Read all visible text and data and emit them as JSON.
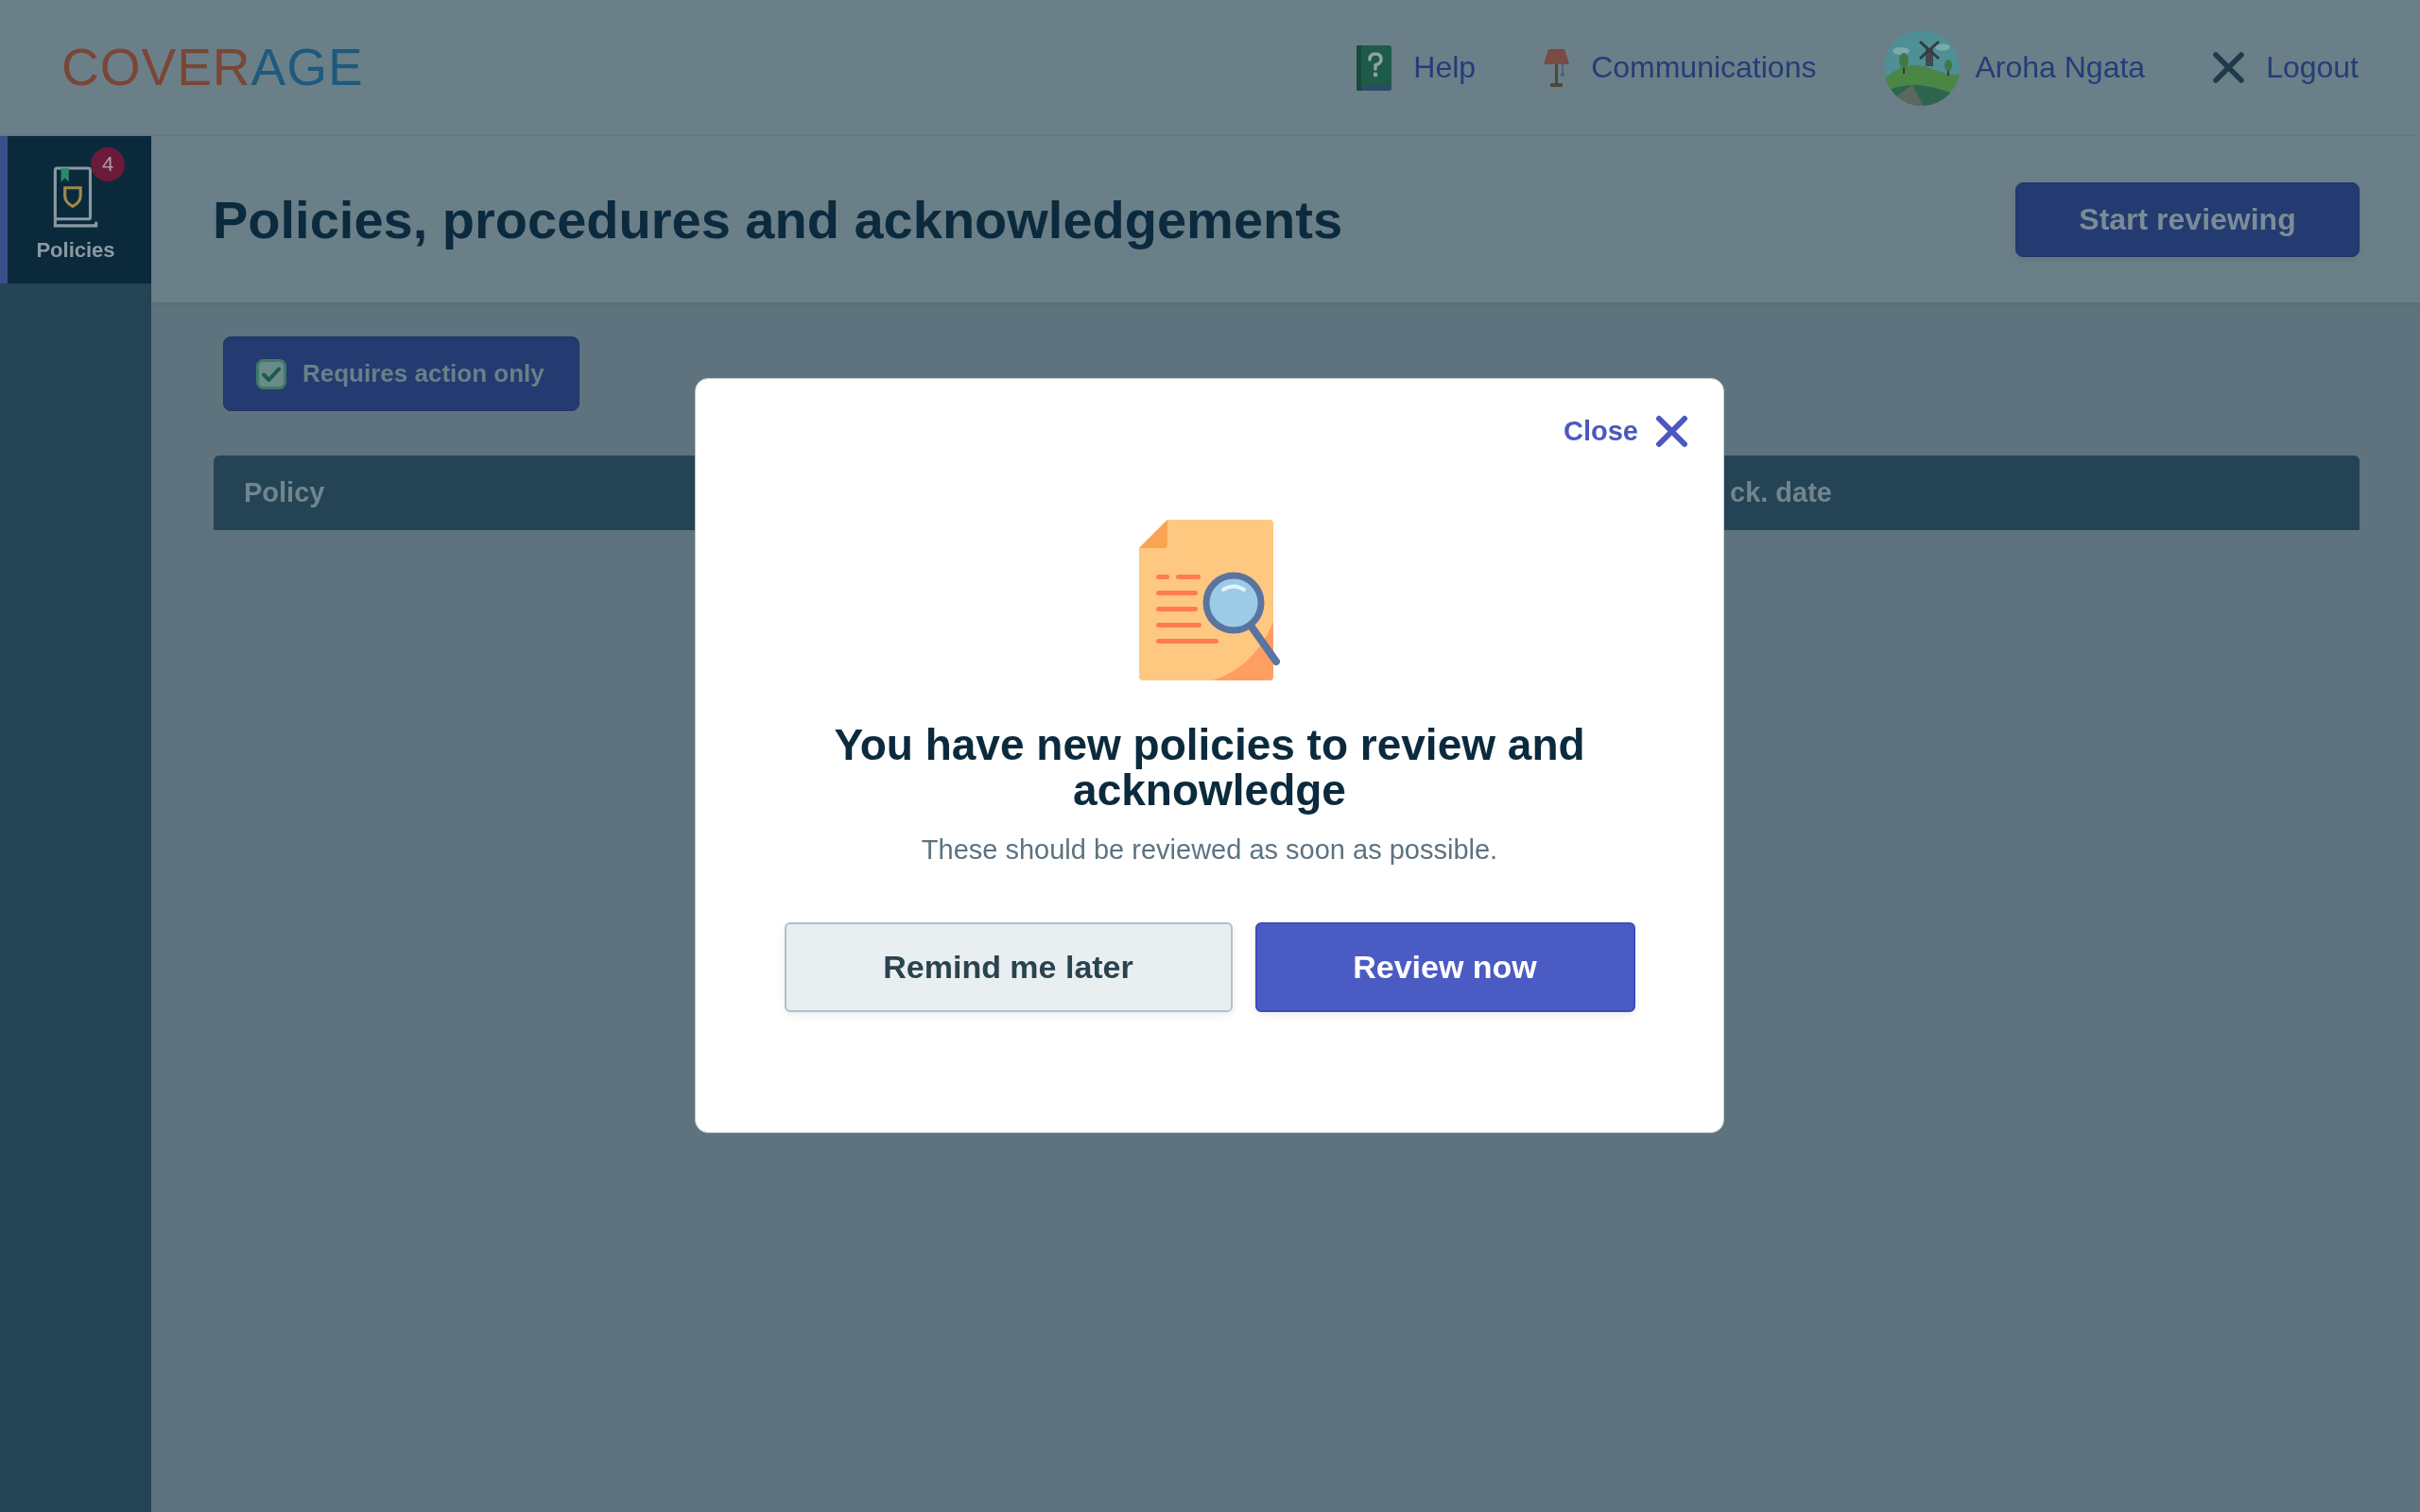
{
  "header": {
    "logo": [
      {
        "text": "COVER",
        "color": "#7a4636"
      },
      {
        "text": "AGE",
        "color": "#1d5a7e"
      }
    ],
    "links": [
      {
        "kind": "help",
        "label": "Help"
      },
      {
        "kind": "communications",
        "label": "Communications"
      },
      {
        "kind": "profile",
        "label": "Aroha Ngata"
      },
      {
        "kind": "logout",
        "label": "Logout"
      }
    ]
  },
  "sidebar": {
    "items": [
      {
        "label": "Policies",
        "badge": "4",
        "selected": true
      }
    ]
  },
  "page": {
    "title": "Policies, procedures and acknowledgements",
    "primary_button": "Start reviewing"
  },
  "filter": {
    "label": "Requires action only",
    "checked": true
  },
  "table": {
    "columns": [
      "Policy",
      "ck. date"
    ]
  },
  "modal": {
    "close_label": "Close",
    "heading": "You have new policies to review and acknowledge",
    "message": "These should be reviewed as soon as possible.",
    "buttons": [
      {
        "kind": "secondary",
        "label": "Remind me later"
      },
      {
        "kind": "primary",
        "label": "Review now"
      }
    ]
  }
}
